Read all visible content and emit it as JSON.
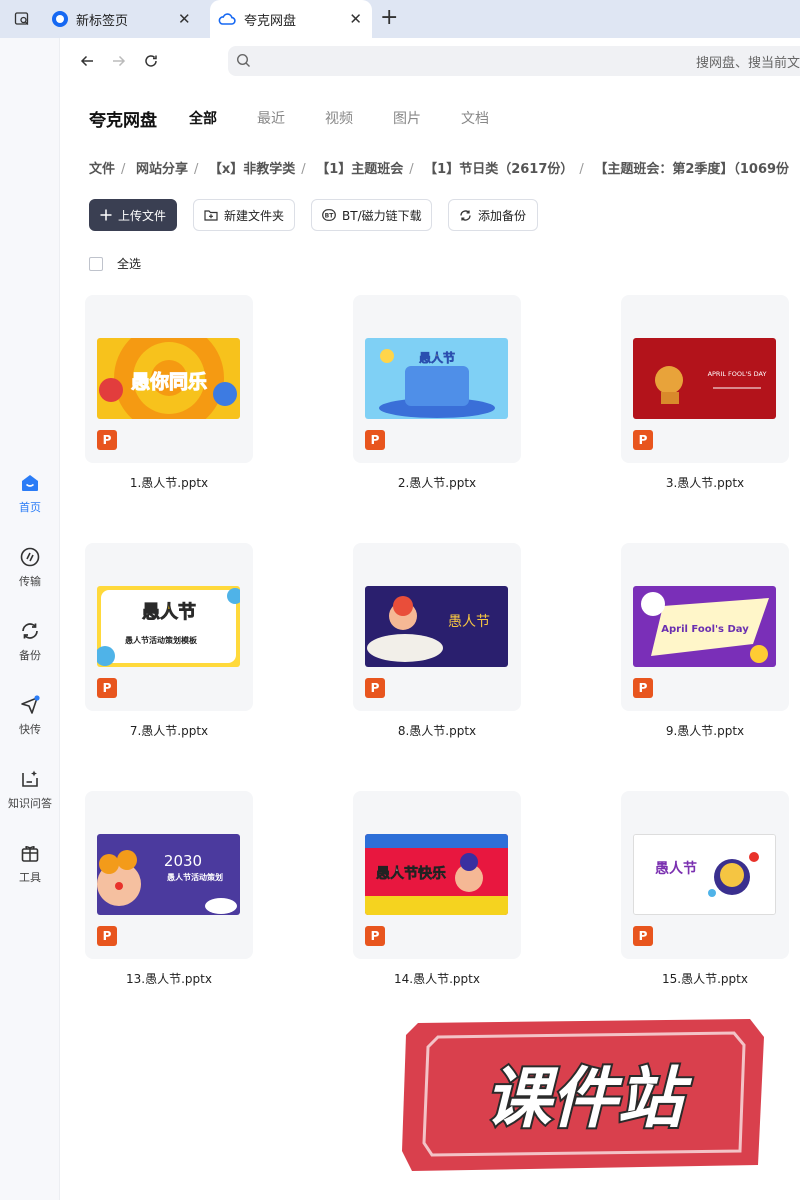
{
  "browser": {
    "tabs": [
      {
        "label": "新标签页"
      },
      {
        "label": "夸克网盘"
      }
    ],
    "address_placeholder": "搜网盘、搜当前文"
  },
  "sidebar": {
    "items": [
      {
        "label": "首页"
      },
      {
        "label": "传输"
      },
      {
        "label": "备份"
      },
      {
        "label": "快传"
      },
      {
        "label": "知识问答"
      },
      {
        "label": "工具"
      }
    ]
  },
  "header": {
    "brand": "夸克网盘",
    "tabs": [
      {
        "label": "全部"
      },
      {
        "label": "最近"
      },
      {
        "label": "视频"
      },
      {
        "label": "图片"
      },
      {
        "label": "文档"
      }
    ]
  },
  "breadcrumb": [
    "文件",
    "网站分享",
    "【x】非教学类",
    "【1】主题班会",
    "【1】节日类（2617份）",
    "【主题班会：第2季度】（1069份"
  ],
  "toolbar": {
    "upload": "上传文件",
    "new_folder": "新建文件夹",
    "bt": "BT/磁力链下载",
    "backup": "添加备份"
  },
  "select_all": "全选",
  "files": [
    {
      "name": "1.愚人节.pptx",
      "thumb_text": "愚你同乐"
    },
    {
      "name": "2.愚人节.pptx",
      "thumb_text": "愚人节"
    },
    {
      "name": "3.愚人节.pptx",
      "thumb_text": "APRIL FOOL'S DAY"
    },
    {
      "name": "7.愚人节.pptx",
      "thumb_text": "愚人节",
      "thumb_sub": "愚人节活动策划模板"
    },
    {
      "name": "8.愚人节.pptx",
      "thumb_text": "愚人节"
    },
    {
      "name": "9.愚人节.pptx",
      "thumb_text": "April Fool's Day"
    },
    {
      "name": "13.愚人节.pptx",
      "thumb_text": "2030",
      "thumb_sub": "愚人节活动策划"
    },
    {
      "name": "14.愚人节.pptx",
      "thumb_text": "愚人节快乐"
    },
    {
      "name": "15.愚人节.pptx",
      "thumb_text": "愚人节"
    }
  ],
  "pptx_badge": "P",
  "watermark": "课件站",
  "colors": {
    "accent": "#2b7cf6",
    "primary_button": "#3a3f52",
    "pptx_badge": "#e8551e",
    "watermark_red": "#d9404d"
  }
}
